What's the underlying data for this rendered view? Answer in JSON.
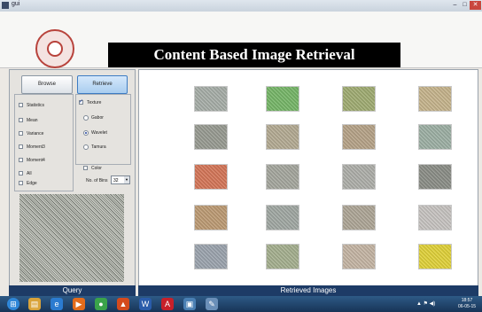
{
  "window": {
    "title": "gui",
    "controls": {
      "minimize": "–",
      "maximize": "□",
      "close": "✕"
    }
  },
  "header": {
    "logo_icon": "institute-seal-icon",
    "title": "Content Based Image Retrieval"
  },
  "controls": {
    "browse_label": "Browse",
    "retrieve_label": "Retrieve",
    "feature_checkboxes": [
      {
        "label": "Statistics",
        "checked": false
      },
      {
        "label": "Mean",
        "checked": false
      },
      {
        "label": "Variance",
        "checked": false
      },
      {
        "label": "Moment3",
        "checked": false
      },
      {
        "label": "Moment4",
        "checked": false
      },
      {
        "label": "All",
        "checked": false
      }
    ],
    "edge_label": "Edge",
    "texture_label": "Texture",
    "texture_checked": true,
    "texture_options": [
      {
        "label": "Gabor",
        "selected": false
      },
      {
        "label": "Wavelet",
        "selected": true
      },
      {
        "label": "Tamura",
        "selected": false
      }
    ],
    "color_label": "Color",
    "bins_label": "No. of Bins",
    "bins_value": "32"
  },
  "query": {
    "caption": "Query",
    "image_icon": "query-texture-image"
  },
  "results": {
    "caption": "Retrieved Images",
    "thumb_colors": [
      "#a9b0aa",
      "#78b86a",
      "#a2ae74",
      "#c8b68e",
      "#9a9d94",
      "#b6ad95",
      "#b8a58a",
      "#9fb2a6",
      "#d7785a",
      "#a7a9a0",
      "#b0b1ac",
      "#8d9089",
      "#bf9d76",
      "#a3aaa5",
      "#b0a899",
      "#c9c6c3",
      "#9ea6b0",
      "#a7b291",
      "#c7b7a6",
      "#e3d43b"
    ]
  },
  "taskbar": {
    "start_icon": "windows-start-icon",
    "apps": [
      "explorer-icon",
      "ie-icon",
      "media-player-icon",
      "chrome-icon",
      "matlab-icon",
      "word-icon",
      "acrobat-icon",
      "paint-icon",
      "tool-icon"
    ],
    "clock_time": "18:57",
    "clock_date": "06-05-15"
  }
}
